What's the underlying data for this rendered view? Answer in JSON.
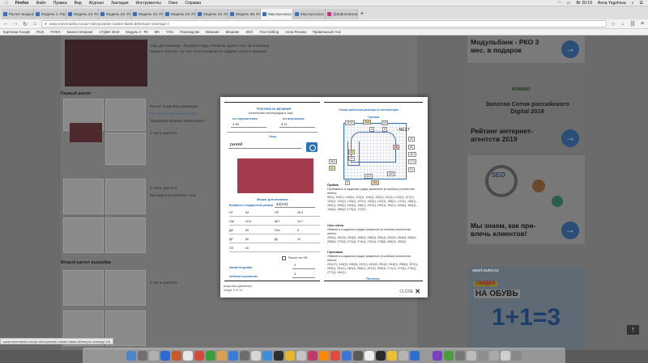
{
  "menubar": {
    "apple": "",
    "items": [
      "Firefox",
      "Файл",
      "Правка",
      "Вид",
      "Журнал",
      "Закладки",
      "Инструменты",
      "Окно",
      "Справка"
    ],
    "time": "Вт 20:19",
    "user": "Anna Yagzhova"
  },
  "tabs": [
    {
      "title": "Расчет выкройки вязани",
      "color": "#3d6fb3"
    },
    {
      "title": "Модель 1. Расчет выкрой",
      "color": "#3d6fb3"
    },
    {
      "title": "Модель 23. Расчет выкрой",
      "color": "#3d6fb3"
    },
    {
      "title": "Модель 23. Расчет выкрой",
      "color": "#3d6fb3"
    },
    {
      "title": "Модель 23. Расчет выкрой",
      "color": "#3d6fb3"
    },
    {
      "title": "Модель 23. Расчет выкрой",
      "color": "#3d6fb3"
    },
    {
      "title": "Модель 23. Расчет выкрой",
      "color": "#3d6fb3"
    },
    {
      "title": "Модель 65. Расчет выкрой",
      "color": "#3d6fb3"
    },
    {
      "title": "Мастер-класс по вязани",
      "color": "#3d6fb3",
      "active": true
    },
    {
      "title": "Мастер-класс по вязани",
      "color": "#3d6fb3"
    },
    {
      "title": "@dubmmemasha • Фото",
      "color": "#c13584"
    }
  ],
  "navbar": {
    "url": "www.mmemasha.ru/vaz-mk/vyazanie-master-klass-dzhemper-oversajz-2",
    "back_icon": "arrow-left-icon",
    "forward_icon": "arrow-right-icon",
    "reload_icon": "reload-icon"
  },
  "bookmarks": [
    "Картинки Google",
    "RUS",
    "FIVEK",
    "Бизнес-вязание",
    "СТДКИ 2018",
    "Модуль 2 - Ре",
    "МК",
    "YOU",
    "Переводчик",
    "Вязание",
    "Вязание",
    "SEO",
    "Free knitting",
    "Анна Ягжова",
    "Правильный сток"
  ],
  "article": {
    "intro_text_1": "Узор для вязания - Лицевая гладь. Ритмика одного пол. за отличием",
    "intro_text_2": "нижнего блестит, за счет этого появляется эффект легкого вязания.",
    "section_1": "Первый расчет",
    "calc_line_1": "Расчет выкройки джемпера",
    "calc_line_2": "Расчет петель в вязальной",
    "calc_line_3": "\"Выкройки вязания Mmemasha\"",
    "part_1": "1 часть расчета",
    "part_2": "2 часть расчета",
    "part_2_sub": "Как видно из расчета - в м",
    "section_2": "Второй расчет выкройки",
    "part_3": "1 часть расчета"
  },
  "ads": {
    "ad1_text": "Модульбанк - РКО 3 мес. в подарок",
    "ad2_logo": "RUWARD",
    "ad2_text": "Золотая Сотня российского Digital 2019",
    "ad3_text": "Рейтинг интернет-агентств 2019",
    "ad4_text": "Мы знаем, как при-влечь клиентов!",
    "ad5_logo": "sport.outer.ru",
    "ad5_text_1": "СКИДКИ",
    "ad5_text_2": "НА ОБУВЬ",
    "ad5_text_3": "1+1=3"
  },
  "modal": {
    "density_title": "Плотность вязания",
    "density_sub": "(количество петель/рядов в 1см)",
    "horizontal_label": "по горизонтали",
    "vertical_label": "по вертикали",
    "horizontal_value": "3.45",
    "vertical_value": "5.11",
    "pattern_label": "Узор",
    "yarn_color": "рыжий",
    "measurements_title": "Мерки для вязания",
    "size_label": "Выбрать стандартный размер",
    "size_value": "42(XS)",
    "measures": [
      {
        "a": "ОГ",
        "av": "84",
        "b": "ОР",
        "bv": "26.3"
      },
      {
        "a": "ОШ",
        "av": "34.6",
        "b": "ШП",
        "bv": "15.7"
      },
      {
        "a": "ДИ",
        "av": "60",
        "b": "Пол",
        "bv": "8"
      },
      {
        "a": "ДР",
        "av": "60",
        "b": "Дс",
        "bv": "12"
      },
      {
        "a": "ОЗ",
        "av": "40",
        "b": "",
        "bv": ""
      }
    ],
    "ob_checkbox_label": "Расчет по ОБ",
    "sleeve_label": "манжета рукава",
    "sleeve_value": "4",
    "neck_label": "обтачка горловины",
    "neck_value": "4",
    "scheme_title": "Схема шаблонов размеры в сантиметрах",
    "back_title": "Спинка",
    "next_label": "NEXT",
    "pattern_dims": [
      "35.35",
      "26.8",
      "8.8",
      "4",
      "8",
      "20",
      "28",
      "56",
      "45.3",
      "44",
      "29",
      "17.5",
      "38.3",
      "14",
      "10",
      "28.5",
      "44.9",
      "5",
      "28.6"
    ],
    "pr_title": "Пройма",
    "pr_text": "Прибавлять в заданных рядах указанное (в скобках) количество петель:",
    "pr_rows": "99(1), 100(1), 106(1), 113(1), 114(1), 119(1), 121(1), 124(1), 127(1), 129(1), 132(1), 134(1), 137(1), 140(1), 142(1), 145(1), 147(1), 148(1), 150(1), 153(1), 154(1), 156(1), 157(1), 159(1), 161(1), 162(1), 163(1), 164(2), 166(2), 170(2), 172(2)",
    "sk_title": "Скос плеча",
    "sk_text": "Убавлять в заданных рядах указанное (в скобках) количество петель:",
    "sk_rows": "250(4), 252(4), 254(5), 256(4), 258(4), 260(4), 262(5), 264(4), 266(4), 268(5), 270(5), 272(4), 274(4), 276(4), 278(5), 280(3), 282(3)",
    "gr_title": "Горловина",
    "gr_text": "Убавлять в заданных рядах указанное (в скобках) количество петель:",
    "gr_rows": "241(17), 243(5), 245(3), 247(2), 249(2), 251(2), 253(2), 255(2), 257(1), 259(1), 261(1), 263(1), 265(1), 267(1), 269(1), 271(1), 273(1), 275(1), 277(1), 281(1)",
    "bottom_label": "Полочка",
    "pager_title": "выкройка джемпера",
    "pager_page": "Image 3 of 14",
    "close_label": "CLOSE"
  },
  "status_url": "www.mmemasha.ru/vaz-mk/vyazanie-master-klass-dzhemper-oversajz-2/#",
  "dock_colors": [
    "#4a86c7",
    "#6f6f6f",
    "#b0b0b0",
    "#2b6bd6",
    "#c65c2c",
    "#e6e6e6",
    "#d44a3a",
    "#3b9d3b",
    "#d8a14a",
    "#3a7bd5",
    "#6d6d6d",
    "#d6d6d6",
    "#3c8fd9",
    "#2e2e2e",
    "#e5b62a",
    "#c5c5c5",
    "#c23a6b",
    "#ff8a00",
    "#e04b3e",
    "#3f76d4",
    "#5a5a5a",
    "#eeeeee",
    "#2a2a2a",
    "#f0c02c",
    "#b3b3b3",
    "#2d6fd2",
    "#9a9a9a",
    "#7a3fc2",
    "#4d9b41",
    "#777",
    "#bbbbbb",
    "#8f8f8f",
    "#aaaaaa",
    "#d0d0d0",
    "#888"
  ]
}
